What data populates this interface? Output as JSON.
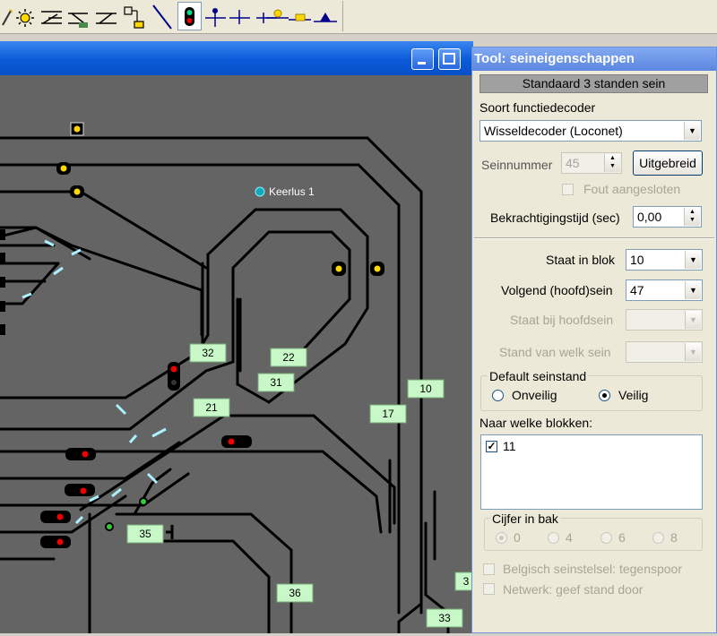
{
  "toolbar": {
    "tools": [
      "pencil-icon",
      "signal-light-icon",
      "turnout-left-icon",
      "turnout-multi-icon",
      "crossing-icon",
      "block-icon",
      "diagonal-track-icon",
      "signal-tool-icon",
      "signal-post-icon",
      "signal-post-2-icon",
      "signal-post-3-icon",
      "signal-yellow-icon",
      "signal-block-icon",
      "signal-triangle-icon"
    ]
  },
  "map": {
    "loop_label": "Keerlus 1",
    "blocks": [
      "32",
      "22",
      "31",
      "21",
      "10",
      "17",
      "35",
      "36",
      "33",
      "3"
    ]
  },
  "panel": {
    "title": "Tool: seineigenschappen",
    "header": "Standaard 3 standen sein",
    "decoder_type_label": "Soort functiedecoder",
    "decoder_type_value": "Wisseldecoder (Loconet)",
    "signal_number_label": "Seinnummer",
    "signal_number_value": "45",
    "extended_button": "Uitgebreid",
    "error_connected_label": "Fout aangesloten",
    "activation_time_label": "Bekrachtigingstijd (sec)",
    "activation_time_value": "0,00",
    "in_block_label": "Staat in blok",
    "in_block_value": "10",
    "next_signal_label": "Volgend (hoofd)sein",
    "next_signal_value": "47",
    "main_signal_label": "Staat bij hoofdsein",
    "which_signal_label": "Stand van welk sein",
    "default_group_label": "Default seinstand",
    "unsafe_label": "Onveilig",
    "safe_label": "Veilig",
    "blocks_label": "Naar welke blokken:",
    "blocks_list": [
      "11"
    ],
    "digit_group_label": "Cijfer in bak",
    "digit_options": [
      "0",
      "4",
      "6",
      "8"
    ],
    "belgian_label": "Belgisch seinstelsel: tegenspoor",
    "network_label": "Netwerk: geef stand door"
  }
}
